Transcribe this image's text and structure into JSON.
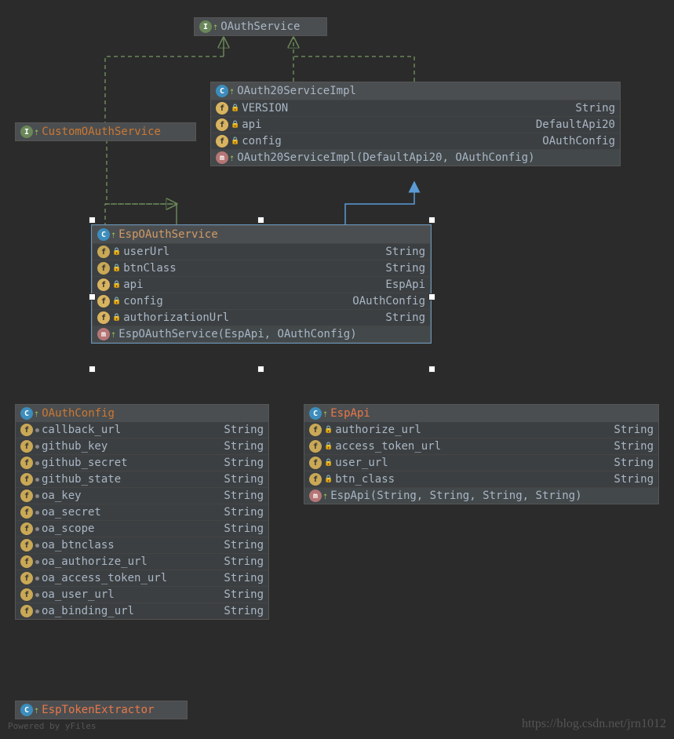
{
  "oauth_service": {
    "name": "OAuthService"
  },
  "custom_oauth": {
    "name": "CustomOAuthService"
  },
  "oauth20impl": {
    "name": "OAuth20ServiceImpl",
    "fields": [
      {
        "name": "VERSION",
        "type": "String"
      },
      {
        "name": "api",
        "type": "DefaultApi20"
      },
      {
        "name": "config",
        "type": "OAuthConfig"
      }
    ],
    "ctor": "OAuth20ServiceImpl(DefaultApi20, OAuthConfig)"
  },
  "esp_oauth": {
    "name": "EspOAuthService",
    "fields": [
      {
        "name": "userUrl",
        "type": "String"
      },
      {
        "name": "btnClass",
        "type": "String"
      },
      {
        "name": "api",
        "type": "EspApi"
      },
      {
        "name": "config",
        "type": "OAuthConfig"
      },
      {
        "name": "authorizationUrl",
        "type": "String"
      }
    ],
    "ctor": "EspOAuthService(EspApi, OAuthConfig)"
  },
  "oauth_config": {
    "name": "OAuthConfig",
    "fields": [
      {
        "name": "callback_url",
        "type": "String"
      },
      {
        "name": "github_key",
        "type": "String"
      },
      {
        "name": "github_secret",
        "type": "String"
      },
      {
        "name": "github_state",
        "type": "String"
      },
      {
        "name": "oa_key",
        "type": "String"
      },
      {
        "name": "oa_secret",
        "type": "String"
      },
      {
        "name": "oa_scope",
        "type": "String"
      },
      {
        "name": "oa_btnclass",
        "type": "String"
      },
      {
        "name": "oa_authorize_url",
        "type": "String"
      },
      {
        "name": "oa_access_token_url",
        "type": "String"
      },
      {
        "name": "oa_user_url",
        "type": "String"
      },
      {
        "name": "oa_binding_url",
        "type": "String"
      }
    ]
  },
  "esp_api": {
    "name": "EspApi",
    "fields": [
      {
        "name": "authorize_url",
        "type": "String"
      },
      {
        "name": "access_token_url",
        "type": "String"
      },
      {
        "name": "user_url",
        "type": "String"
      },
      {
        "name": "btn_class",
        "type": "String"
      }
    ],
    "ctor": "EspApi(String, String, String, String)"
  },
  "esp_token": {
    "name": "EspTokenExtractor"
  },
  "watermark": "https://blog.csdn.net/jrn1012",
  "powered": "Powered by yFiles"
}
